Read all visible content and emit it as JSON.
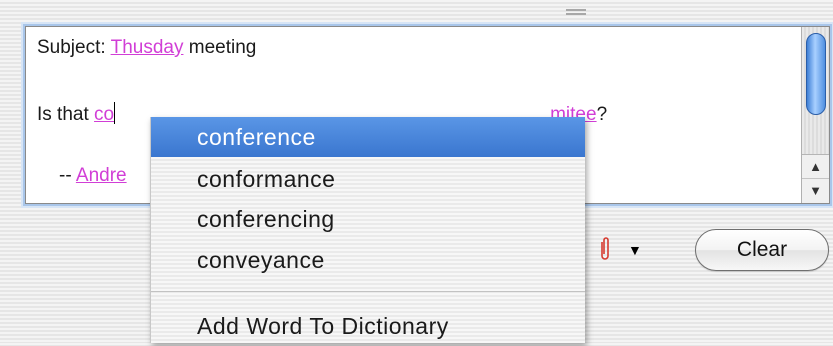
{
  "editor": {
    "subject_label": "Subject: ",
    "subject_misspelled": "Thusday",
    "subject_rest": " meeting",
    "body_prefix": "Is that ",
    "body_word_start": "co",
    "body_word_end": "mitee",
    "body_end": "?",
    "signature_prefix": "-- ",
    "signature_name": "Andre"
  },
  "toolbar": {
    "attach_icon": "paperclip-icon",
    "popup_icon": "triangle-down-icon",
    "clear_label": "Clear"
  },
  "context_menu": {
    "suggestions": [
      "conference",
      "conformance",
      "conferencing",
      "conveyance"
    ],
    "selected_index": 0,
    "add_word_label": "Add Word To Dictionary"
  },
  "colors": {
    "misspelled": "#d13ed6",
    "selection": "#3a76cf",
    "focus_ring": "#a9c6ea"
  }
}
